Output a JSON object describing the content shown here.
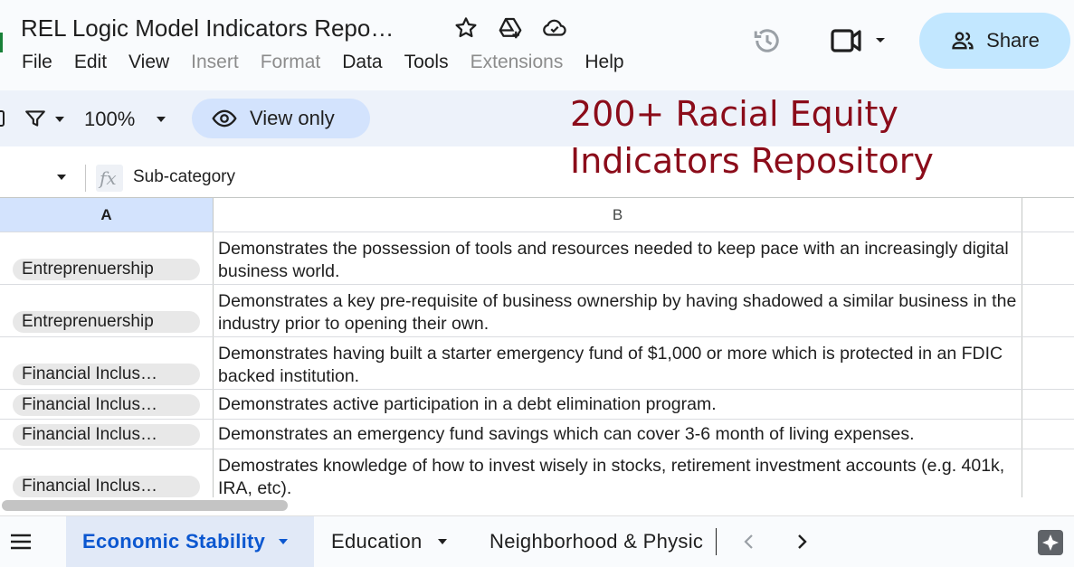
{
  "app": {
    "doc_title": "REL Logic Model Indicators Repo…",
    "menu": [
      "File",
      "Edit",
      "View",
      "Insert",
      "Format",
      "Data",
      "Tools",
      "Extensions",
      "Help"
    ],
    "menu_disabled": [
      "Insert",
      "Format",
      "Extensions"
    ],
    "share_label": "Share",
    "accent_color": "#c2e7ff"
  },
  "toolbar": {
    "zoom": "100%",
    "view_only_label": "View only"
  },
  "overlay": {
    "heading": "200+ Racial Equity Indicators Repository",
    "color": "#8b0c1a"
  },
  "formula_bar": {
    "content": "Sub-category"
  },
  "grid": {
    "columns": [
      "A",
      "B"
    ],
    "rows": [
      {
        "a": "Entreprenuership",
        "b": "Demonstrates the possession of tools and resources needed to keep pace with an increasingly digital business world."
      },
      {
        "a": "Entreprenuership",
        "b": "Demonstrates a key pre-requisite of business ownership by having shadowed a similar business in the industry prior to opening their own."
      },
      {
        "a": "Financial Inclus…",
        "b": "Demonstrates having built a starter emergency fund of $1,000 or more which is protected in an FDIC backed institution."
      },
      {
        "a": "Financial Inclus…",
        "b": "Demonstrates active participation in a debt elimination program."
      },
      {
        "a": "Financial Inclus…",
        "b": "Demonstrates an emergency fund savings which can cover 3-6 month of living expenses."
      },
      {
        "a": "Financial Inclus…",
        "b": "Demostrates knowledge of how to invest wisely in stocks, retirement investment accounts (e.g. 401k, IRA, etc)."
      }
    ]
  },
  "tabs": [
    {
      "label": "Economic Stability",
      "active": true
    },
    {
      "label": "Education",
      "active": false
    },
    {
      "label": "Neighborhood & Physic",
      "active": false
    }
  ],
  "icons": [
    "star-icon",
    "move-to-drive-icon",
    "cloud-status-icon",
    "version-history-icon",
    "meet-icon",
    "share-people-icon",
    "filter-icon",
    "eye-icon",
    "fx-icon",
    "all-sheets-icon",
    "chevron-left-icon",
    "chevron-right-icon",
    "explore-icon"
  ]
}
